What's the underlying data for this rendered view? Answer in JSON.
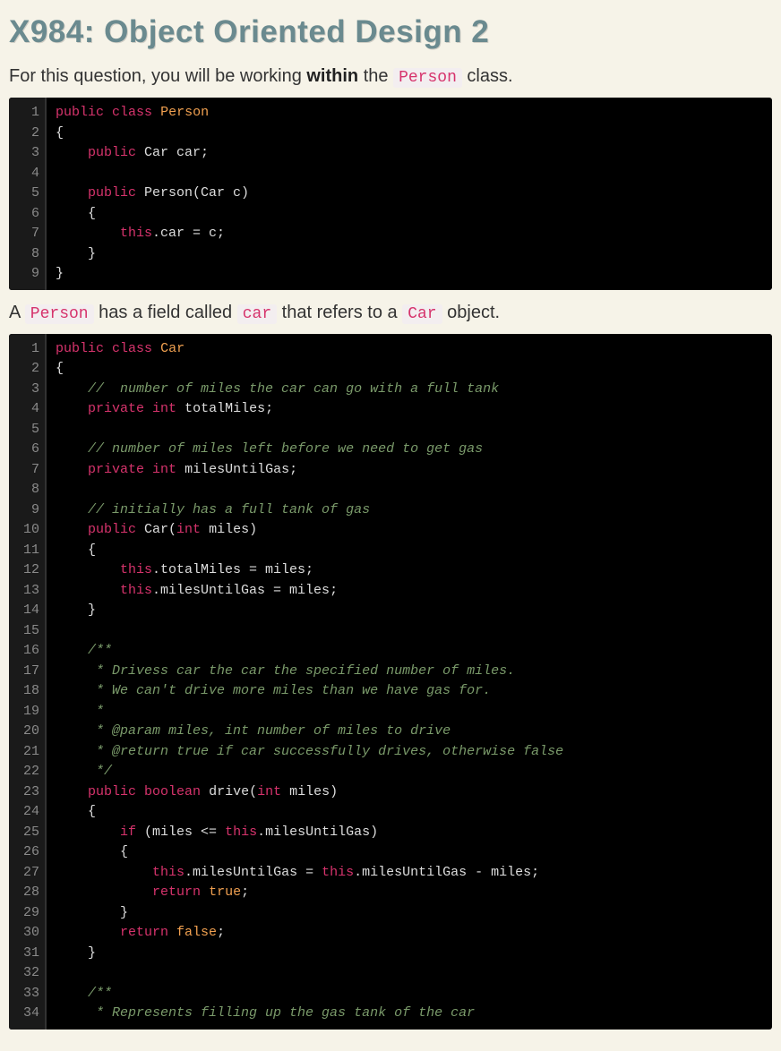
{
  "title": "X984: Object Oriented Design 2",
  "intro_parts": {
    "p1": "For this question, you will be working ",
    "bold": "within",
    "p2": " the ",
    "code": "Person",
    "p3": " class."
  },
  "mid_parts": {
    "p1": "A ",
    "code1": "Person",
    "p2": " has a field called ",
    "code2": "car",
    "p3": " that refers to a ",
    "code3": "Car",
    "p4": " object."
  },
  "code1": {
    "line_count": 9,
    "lines": [
      [
        [
          "kw",
          "public"
        ],
        [
          "id",
          " "
        ],
        [
          "kw",
          "class"
        ],
        [
          "id",
          " "
        ],
        [
          "tn",
          "Person"
        ]
      ],
      [
        [
          "id",
          "{"
        ]
      ],
      [
        [
          "id",
          "    "
        ],
        [
          "kw",
          "public"
        ],
        [
          "id",
          " Car car;"
        ]
      ],
      [
        [
          "id",
          " "
        ]
      ],
      [
        [
          "id",
          "    "
        ],
        [
          "kw",
          "public"
        ],
        [
          "id",
          " Person(Car c)"
        ]
      ],
      [
        [
          "id",
          "    {"
        ]
      ],
      [
        [
          "id",
          "        "
        ],
        [
          "kw",
          "this"
        ],
        [
          "id",
          ".car = c;"
        ]
      ],
      [
        [
          "id",
          "    }"
        ]
      ],
      [
        [
          "id",
          "}"
        ]
      ]
    ]
  },
  "code2": {
    "line_count": 34,
    "lines": [
      [
        [
          "kw",
          "public"
        ],
        [
          "id",
          " "
        ],
        [
          "kw",
          "class"
        ],
        [
          "id",
          " "
        ],
        [
          "tn",
          "Car"
        ]
      ],
      [
        [
          "id",
          "{"
        ]
      ],
      [
        [
          "id",
          "    "
        ],
        [
          "cm",
          "//  number of miles the car can go with a full tank"
        ]
      ],
      [
        [
          "id",
          "    "
        ],
        [
          "kw",
          "private"
        ],
        [
          "id",
          " "
        ],
        [
          "kw",
          "int"
        ],
        [
          "id",
          " totalMiles;"
        ]
      ],
      [
        [
          "id",
          " "
        ]
      ],
      [
        [
          "id",
          "    "
        ],
        [
          "cm",
          "// number of miles left before we need to get gas"
        ]
      ],
      [
        [
          "id",
          "    "
        ],
        [
          "kw",
          "private"
        ],
        [
          "id",
          " "
        ],
        [
          "kw",
          "int"
        ],
        [
          "id",
          " milesUntilGas;"
        ]
      ],
      [
        [
          "id",
          " "
        ]
      ],
      [
        [
          "id",
          "    "
        ],
        [
          "cm",
          "// initially has a full tank of gas"
        ]
      ],
      [
        [
          "id",
          "    "
        ],
        [
          "kw",
          "public"
        ],
        [
          "id",
          " Car("
        ],
        [
          "kw",
          "int"
        ],
        [
          "id",
          " miles)"
        ]
      ],
      [
        [
          "id",
          "    {"
        ]
      ],
      [
        [
          "id",
          "        "
        ],
        [
          "kw",
          "this"
        ],
        [
          "id",
          ".totalMiles = miles;"
        ]
      ],
      [
        [
          "id",
          "        "
        ],
        [
          "kw",
          "this"
        ],
        [
          "id",
          ".milesUntilGas = miles;"
        ]
      ],
      [
        [
          "id",
          "    }"
        ]
      ],
      [
        [
          "id",
          " "
        ]
      ],
      [
        [
          "id",
          "    "
        ],
        [
          "cm",
          "/**"
        ]
      ],
      [
        [
          "id",
          "    "
        ],
        [
          "cm",
          " * Drivess car the car the specified number of miles."
        ]
      ],
      [
        [
          "id",
          "    "
        ],
        [
          "cm",
          " * We can't drive more miles than we have gas for."
        ]
      ],
      [
        [
          "id",
          "    "
        ],
        [
          "cm",
          " *"
        ]
      ],
      [
        [
          "id",
          "    "
        ],
        [
          "cm",
          " * @param miles, int number of miles to drive"
        ]
      ],
      [
        [
          "id",
          "    "
        ],
        [
          "cm",
          " * @return true if car successfully drives, otherwise false"
        ]
      ],
      [
        [
          "id",
          "    "
        ],
        [
          "cm",
          " */"
        ]
      ],
      [
        [
          "id",
          "    "
        ],
        [
          "kw",
          "public"
        ],
        [
          "id",
          " "
        ],
        [
          "kw",
          "boolean"
        ],
        [
          "id",
          " drive("
        ],
        [
          "kw",
          "int"
        ],
        [
          "id",
          " miles)"
        ]
      ],
      [
        [
          "id",
          "    {"
        ]
      ],
      [
        [
          "id",
          "        "
        ],
        [
          "kw",
          "if"
        ],
        [
          "id",
          " (miles <= "
        ],
        [
          "kw",
          "this"
        ],
        [
          "id",
          ".milesUntilGas)"
        ]
      ],
      [
        [
          "id",
          "        {"
        ]
      ],
      [
        [
          "id",
          "            "
        ],
        [
          "kw",
          "this"
        ],
        [
          "id",
          ".milesUntilGas = "
        ],
        [
          "kw",
          "this"
        ],
        [
          "id",
          ".milesUntilGas - miles;"
        ]
      ],
      [
        [
          "id",
          "            "
        ],
        [
          "kw",
          "return"
        ],
        [
          "id",
          " "
        ],
        [
          "lt",
          "true"
        ],
        [
          "id",
          ";"
        ]
      ],
      [
        [
          "id",
          "        }"
        ]
      ],
      [
        [
          "id",
          "        "
        ],
        [
          "kw",
          "return"
        ],
        [
          "id",
          " "
        ],
        [
          "lt",
          "false"
        ],
        [
          "id",
          ";"
        ]
      ],
      [
        [
          "id",
          "    }"
        ]
      ],
      [
        [
          "id",
          " "
        ]
      ],
      [
        [
          "id",
          "    "
        ],
        [
          "cm",
          "/**"
        ]
      ],
      [
        [
          "id",
          "    "
        ],
        [
          "cm",
          " * Represents filling up the gas tank of the car"
        ]
      ]
    ]
  }
}
